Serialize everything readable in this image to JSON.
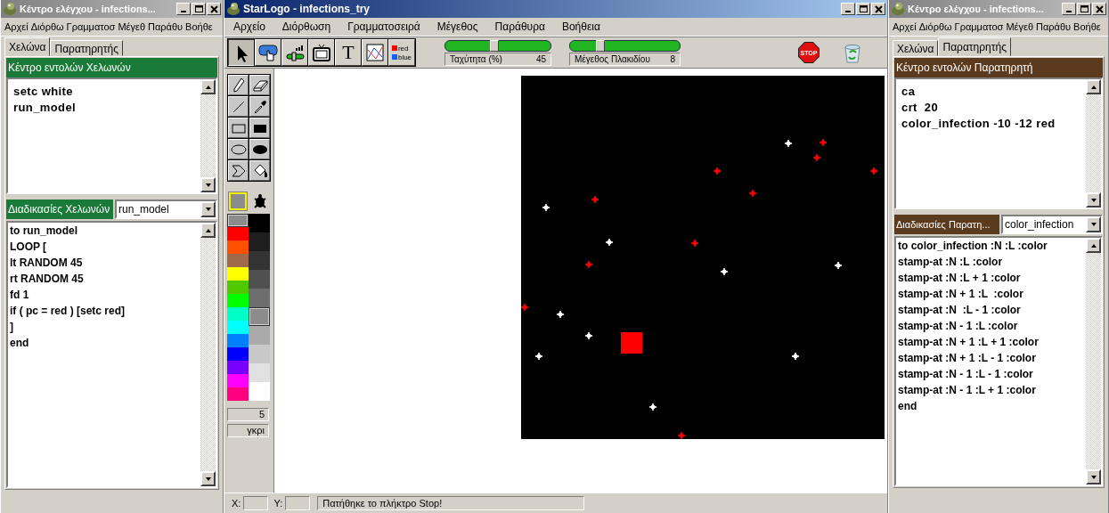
{
  "windows": [
    {
      "kind": "control-center",
      "active": false,
      "title": "Κέντρο ελέγχου - infections...",
      "menu": [
        "Αρχεί",
        "Διόρθω",
        "Γραμματοσ",
        "Μέγεθ",
        "Παράθυ",
        "Βοήθε"
      ],
      "tabs": [
        {
          "label": "Χελώνα",
          "selected": true
        },
        {
          "label": "Παρατηρητής",
          "selected": false
        }
      ],
      "command_center": {
        "header": "Κέντρο εντολών Χελωνών",
        "lines": [
          "setc white",
          "run_model"
        ]
      },
      "procedures": {
        "header": "Διαδικασίες Χελωνών",
        "selected_procedure": "run_model",
        "lines": [
          "to run_model",
          "LOOP [",
          "lt RANDOM 45",
          "rt RANDOM 45",
          "fd 1",
          "if ( pc = red ) [setc red]",
          "]",
          "end"
        ]
      }
    },
    {
      "kind": "starlogo",
      "active": true,
      "title": "StarLogo - infections_try",
      "menu": [
        "Αρχείο",
        "Διόρθωση",
        "Γραμματοσειρά",
        "Μέγεθος",
        "Παράθυρα",
        "Βοήθεια"
      ],
      "tools": [
        {
          "kind": "pointer",
          "selected": true
        },
        {
          "kind": "button",
          "selected": false
        },
        {
          "kind": "slider",
          "selected": false
        },
        {
          "kind": "monitor",
          "selected": false
        },
        {
          "kind": "text",
          "label": "T",
          "selected": false
        },
        {
          "kind": "graph",
          "selected": false
        },
        {
          "kind": "color-chooser",
          "labels": [
            "red",
            "blue"
          ],
          "selected": false
        }
      ],
      "sliders": [
        {
          "label": "Ταχύτητα (%)",
          "value": "45",
          "level": 0.46
        },
        {
          "label": "Μέγεθος Πλακιδίου",
          "value": "8",
          "level": 0.27
        }
      ],
      "stop_button": {
        "label": "STOP"
      },
      "paint_tools": [
        {
          "kind": "pencil"
        },
        {
          "kind": "eraser"
        },
        {
          "kind": "line"
        },
        {
          "kind": "eyedropper"
        },
        {
          "kind": "rectangle"
        },
        {
          "kind": "filled-rectangle"
        },
        {
          "kind": "ellipse"
        },
        {
          "kind": "filled-ellipse"
        },
        {
          "kind": "stamp"
        },
        {
          "kind": "fill"
        }
      ],
      "current_color": {
        "color": "#8c8c8c"
      },
      "palette_columns": [
        {
          "swatches": [
            {
              "color": "#8c8c8c",
              "selected": true
            },
            {
              "color": "#ff0000",
              "selected": false
            },
            {
              "color": "#ff5000",
              "selected": false
            },
            {
              "color": "#a0694b",
              "selected": false
            },
            {
              "color": "#ffff00",
              "selected": false
            },
            {
              "color": "#50c800",
              "selected": false
            },
            {
              "color": "#00ff00",
              "selected": false
            },
            {
              "color": "#00ffc8",
              "selected": false
            },
            {
              "color": "#00ffff",
              "selected": false
            },
            {
              "color": "#0080ff",
              "selected": false
            },
            {
              "color": "#0000ff",
              "selected": false
            },
            {
              "color": "#7800ff",
              "selected": false
            },
            {
              "color": "#ff00ff",
              "selected": false
            },
            {
              "color": "#ff0080",
              "selected": false
            }
          ]
        },
        {
          "swatches": [
            {
              "color": "#000000",
              "selected": false
            },
            {
              "color": "#1e1e1e",
              "selected": false
            },
            {
              "color": "#333333",
              "selected": false
            },
            {
              "color": "#505050",
              "selected": false
            },
            {
              "color": "#6e6e6e",
              "selected": false
            },
            {
              "color": "#8c8c8c",
              "selected": true
            },
            {
              "color": "#aaaaaa",
              "selected": false
            },
            {
              "color": "#c8c8c8",
              "selected": false
            },
            {
              "color": "#e1e1e1",
              "selected": false
            },
            {
              "color": "#ffffff",
              "selected": false
            }
          ]
        }
      ],
      "pen_size": "5",
      "color_name": "γκρι",
      "status_bar": {
        "x_label": "X:",
        "y_label": "Y:",
        "message": "Πατήθηκε το πλήκτρο Stop!"
      }
    },
    {
      "kind": "control-center",
      "active": false,
      "title": "Κέντρο ελέγχου - infections...",
      "menu": [
        "Αρχεί",
        "Διόρθω",
        "Γραμματοσ",
        "Μέγεθ",
        "Παράθυ",
        "Βοήθε"
      ],
      "tabs": [
        {
          "label": "Χελώνα",
          "selected": false
        },
        {
          "label": "Παρατηρητής",
          "selected": true
        }
      ],
      "command_center": {
        "header": "Κέντρο εντολών Παρατηρητή",
        "lines": [
          "ca",
          "crt  20",
          "color_infection -10 -12 red"
        ]
      },
      "procedures": {
        "header": "Διαδικασίες Παρατη...",
        "selected_procedure": "color_infection",
        "lines": [
          "to color_infection :N :L :color",
          "stamp-at :N :L :color",
          "stamp-at :N :L + 1 :color",
          "stamp-at :N + 1 :L  :color",
          "stamp-at :N  :L - 1 :color",
          "stamp-at :N - 1 :L :color",
          "stamp-at :N + 1 :L + 1 :color",
          "stamp-at :N + 1 :L - 1 :color",
          "stamp-at :N - 1 :L - 1 :color",
          "stamp-at :N - 1 :L + 1 :color",
          "end"
        ]
      }
    }
  ]
}
